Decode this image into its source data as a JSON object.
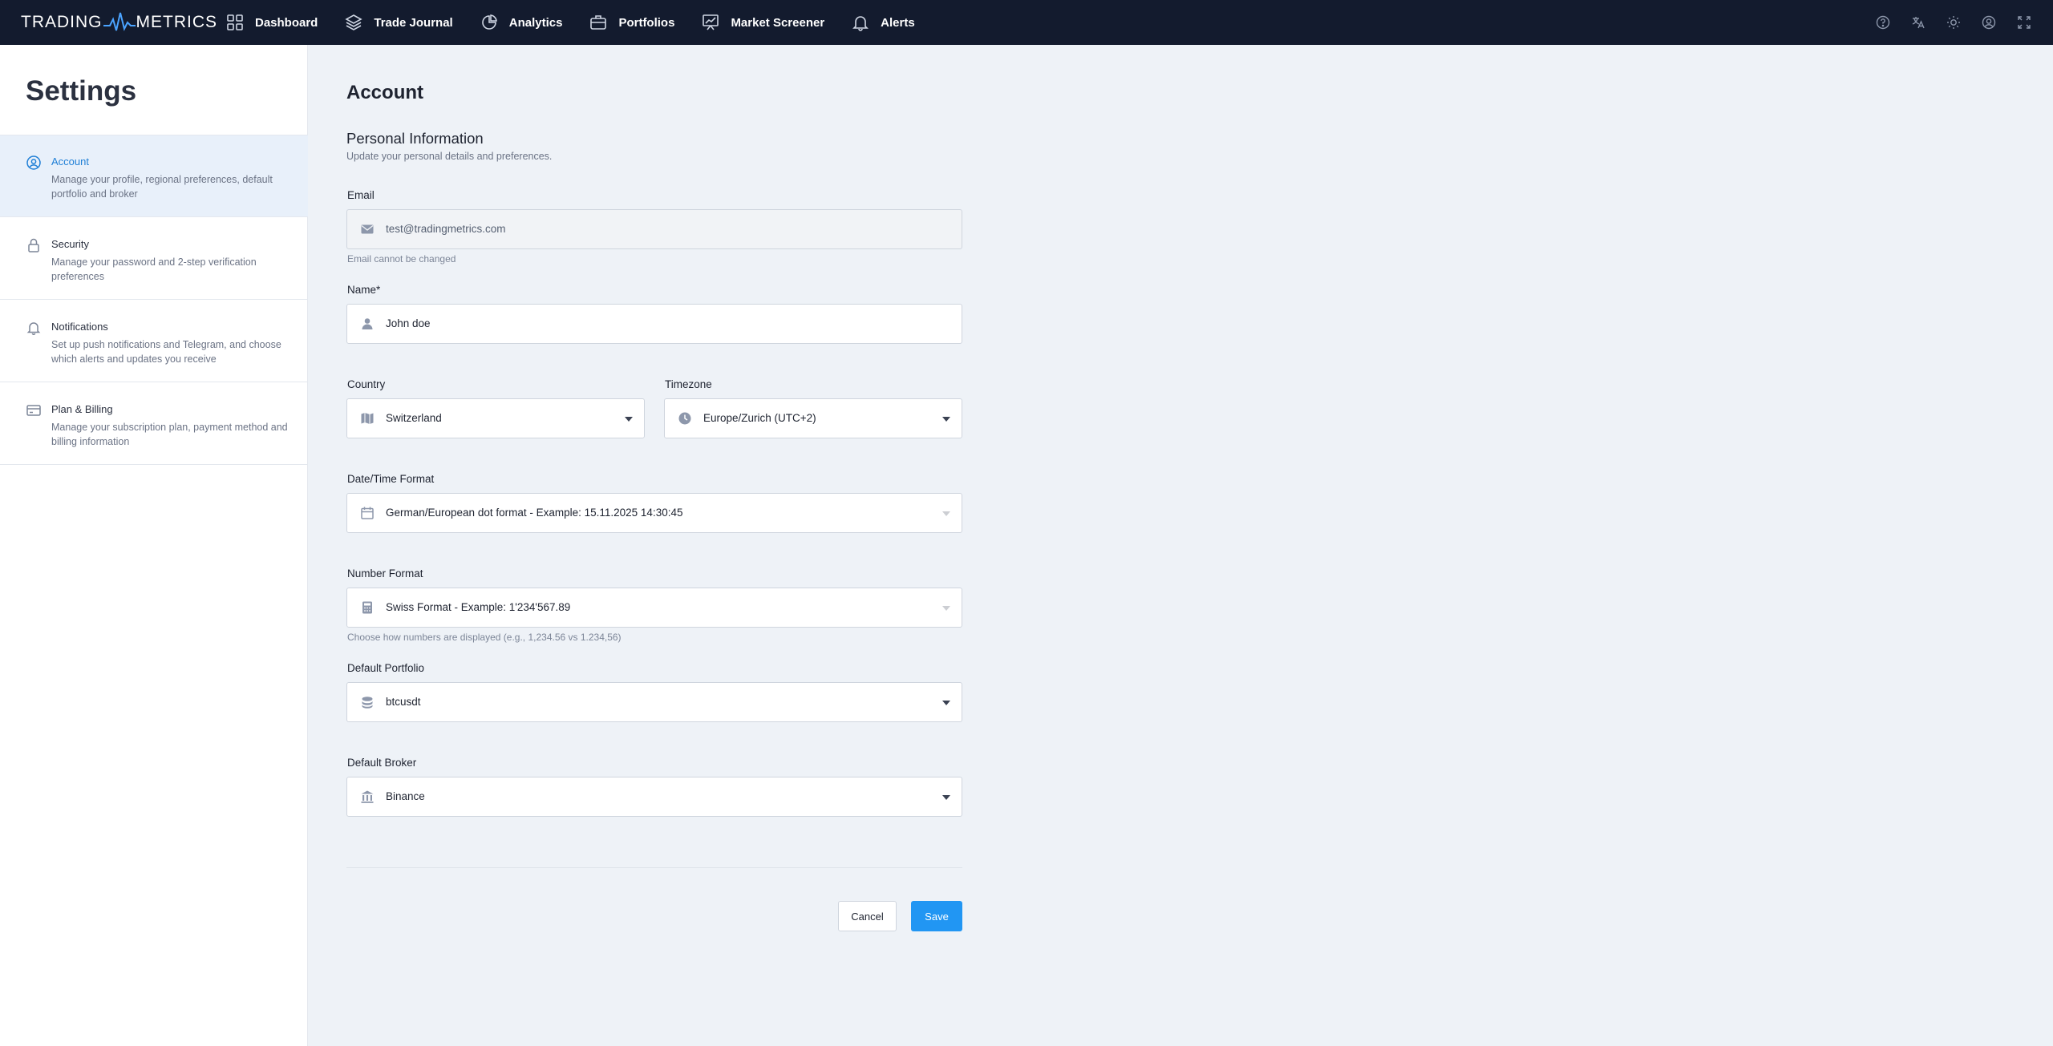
{
  "app": {
    "logo_left": "TRADING",
    "logo_right": "METRICS"
  },
  "nav": [
    {
      "label": "Dashboard",
      "icon": "grid-icon"
    },
    {
      "label": "Trade Journal",
      "icon": "layers-icon"
    },
    {
      "label": "Analytics",
      "icon": "pie-chart-icon"
    },
    {
      "label": "Portfolios",
      "icon": "briefcase-icon"
    },
    {
      "label": "Market Screener",
      "icon": "presentation-chart-icon"
    },
    {
      "label": "Alerts",
      "icon": "bell-icon"
    }
  ],
  "top_icons": [
    "help-icon",
    "translate-icon",
    "theme-sun-icon",
    "user-icon",
    "fullscreen-icon"
  ],
  "sidebar": {
    "title": "Settings",
    "items": [
      {
        "label": "Account",
        "description": "Manage your profile, regional preferences, default portfolio and broker",
        "icon": "user-circle-icon",
        "active": true
      },
      {
        "label": "Security",
        "description": "Manage your password and 2-step verification preferences",
        "icon": "lock-icon",
        "active": false
      },
      {
        "label": "Notifications",
        "description": "Set up push notifications and Telegram, and choose which alerts and updates you receive",
        "icon": "bell-icon",
        "active": false
      },
      {
        "label": "Plan & Billing",
        "description": "Manage your subscription plan, payment method and billing information",
        "icon": "credit-card-icon",
        "active": false
      }
    ]
  },
  "main": {
    "title": "Account",
    "section_title": "Personal Information",
    "section_subtitle": "Update your personal details and preferences.",
    "email": {
      "label": "Email",
      "value": "test@tradingmetrics.com",
      "hint": "Email cannot be changed"
    },
    "name": {
      "label": "Name*",
      "value": "John doe"
    },
    "country": {
      "label": "Country",
      "value": "Switzerland"
    },
    "timezone": {
      "label": "Timezone",
      "value": "Europe/Zurich (UTC+2)"
    },
    "datetime_format": {
      "label": "Date/Time Format",
      "value": "German/European dot format - Example: 15.11.2025 14:30:45"
    },
    "number_format": {
      "label": "Number Format",
      "value": "Swiss Format - Example: 1'234'567.89",
      "hint": "Choose how numbers are displayed (e.g., 1,234.56 vs 1.234,56)"
    },
    "default_portfolio": {
      "label": "Default Portfolio",
      "value": "btcusdt"
    },
    "default_broker": {
      "label": "Default Broker",
      "value": "Binance"
    },
    "cancel_label": "Cancel",
    "save_label": "Save"
  },
  "colors": {
    "topbar": "#131b2e",
    "accent": "#2196f3",
    "active_bg": "#e8f0fa",
    "page_bg": "#eef2f7"
  }
}
